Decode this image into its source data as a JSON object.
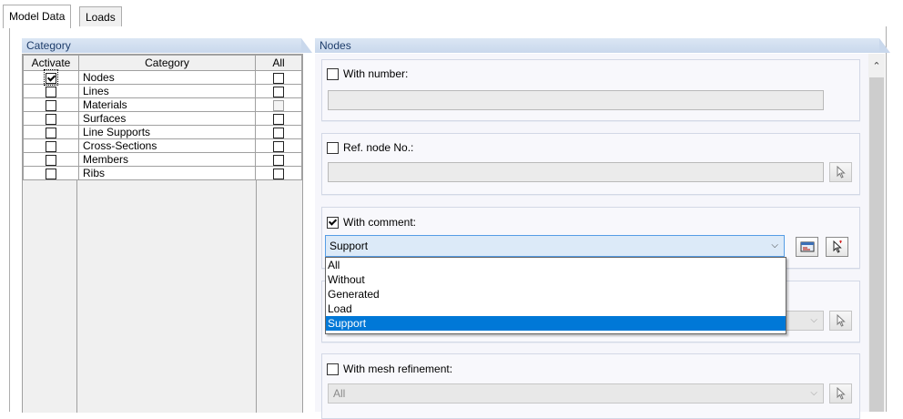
{
  "tabs": [
    {
      "label": "Model Data",
      "active": true
    },
    {
      "label": "Loads",
      "active": false
    }
  ],
  "category_panel": {
    "title": "Category",
    "headers": {
      "activate": "Activate",
      "category": "Category",
      "all": "All"
    },
    "rows": [
      {
        "name": "Nodes",
        "activate": true,
        "all": false,
        "all_enabled": true
      },
      {
        "name": "Lines",
        "activate": false,
        "all": false,
        "all_enabled": true
      },
      {
        "name": "Materials",
        "activate": false,
        "all": false,
        "all_enabled": false
      },
      {
        "name": "Surfaces",
        "activate": false,
        "all": false,
        "all_enabled": true
      },
      {
        "name": "Line Supports",
        "activate": false,
        "all": false,
        "all_enabled": true
      },
      {
        "name": "Cross-Sections",
        "activate": false,
        "all": false,
        "all_enabled": true
      },
      {
        "name": "Members",
        "activate": false,
        "all": false,
        "all_enabled": true
      },
      {
        "name": "Ribs",
        "activate": false,
        "all": false,
        "all_enabled": true
      }
    ]
  },
  "nodes_panel": {
    "title": "Nodes",
    "with_number": {
      "label": "With number:",
      "checked": false,
      "value": ""
    },
    "ref_node": {
      "label": "Ref. node No.:",
      "checked": false,
      "value": ""
    },
    "with_comment": {
      "label": "With comment:",
      "checked": true,
      "selected": "Support",
      "options": [
        "All",
        "Without",
        "Generated",
        "Load",
        "Support"
      ]
    },
    "hidden_group": {
      "value": ""
    },
    "with_mesh_refinement": {
      "label": "With mesh refinement:",
      "checked": false,
      "selected": "All"
    }
  },
  "icons": {
    "pick": "pick-cursor-icon",
    "library": "comment-library-icon",
    "dropdown": "chevron-down-icon",
    "scroll_up": "scroll-up-arrow-icon"
  },
  "colors": {
    "header_bg": "#c9d8ec",
    "selection": "#0078d7",
    "combo_focus_border": "#569de5"
  }
}
